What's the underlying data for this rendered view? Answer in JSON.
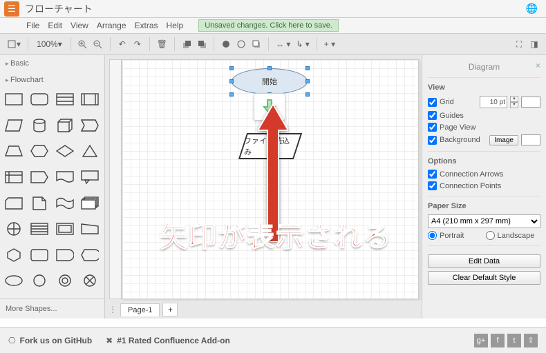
{
  "title": "フローチャート",
  "menu": [
    "File",
    "Edit",
    "View",
    "Arrange",
    "Extras",
    "Help"
  ],
  "save_hint": "Unsaved changes. Click here to save.",
  "zoom": "100%",
  "sidebar": {
    "groups": [
      "Basic",
      "Flowchart"
    ],
    "more": "More Shapes..."
  },
  "canvas": {
    "start_label": "開始",
    "proc_label": "ファイル読込み",
    "overlay": "矢印が表示される",
    "page_tab": "Page-1"
  },
  "panel": {
    "title": "Diagram",
    "view": {
      "heading": "View",
      "grid": "Grid",
      "grid_val": "10 pt",
      "guides": "Guides",
      "page_view": "Page View",
      "background": "Background",
      "image_btn": "Image"
    },
    "options": {
      "heading": "Options",
      "conn_arrows": "Connection Arrows",
      "conn_points": "Connection Points"
    },
    "paper": {
      "heading": "Paper Size",
      "value": "A4 (210 mm x 297 mm)",
      "portrait": "Portrait",
      "landscape": "Landscape"
    },
    "edit_data": "Edit Data",
    "clear_style": "Clear Default Style"
  },
  "footer": {
    "fork": "Fork us on GitHub",
    "conf": "#1 Rated Confluence Add-on"
  }
}
